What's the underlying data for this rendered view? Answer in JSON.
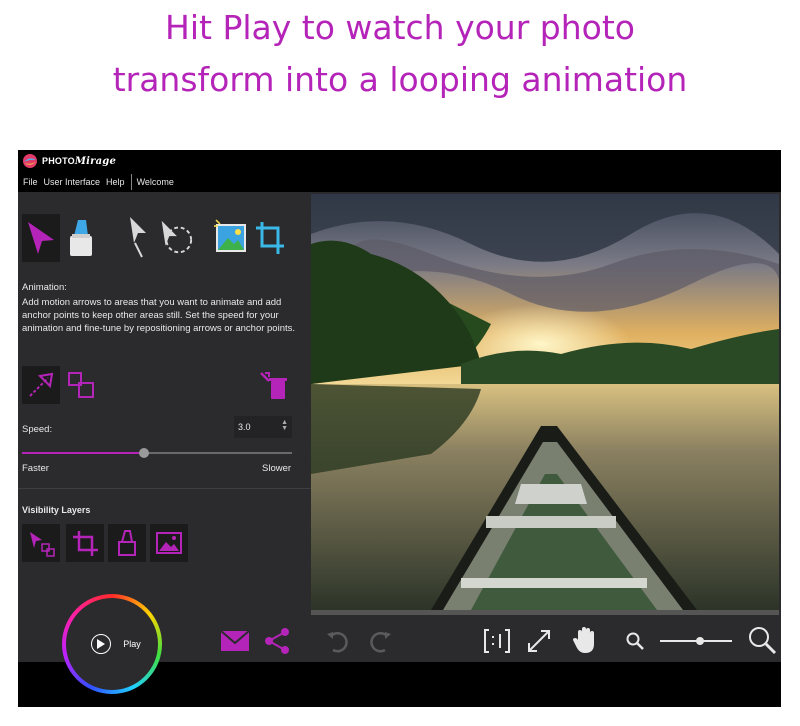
{
  "headline": {
    "line1": "Hit Play to watch your photo",
    "line2": "transform into a looping animation"
  },
  "app": {
    "brand_prefix": "PHOTO",
    "brand_name": "Mirage",
    "menu": [
      "File",
      "User Interface",
      "Help",
      "Welcome"
    ]
  },
  "panel": {
    "tools": [
      "motion-arrow-tool",
      "mask-tool",
      "anchor-point-tool",
      "selection-tool",
      "image-tool",
      "crop-tool"
    ],
    "animation_title": "Animation:",
    "animation_desc": "Add motion arrows to areas that you want to animate and add anchor points to keep other areas still. Set the speed for your animation and fine-tune by repositioning arrows or anchor points.",
    "speed_label": "Speed:",
    "speed_value": "3.0",
    "speed_fraction": 0.45,
    "faster_label": "Faster",
    "slower_label": "Slower",
    "visibility_title": "Visibility Layers"
  },
  "bottom": {
    "play_label": "Play",
    "zoom_fraction": 0.55
  },
  "colors": {
    "accent": "#b524b8",
    "panel": "#2b2b2d",
    "dark": "#1b1b1c"
  }
}
